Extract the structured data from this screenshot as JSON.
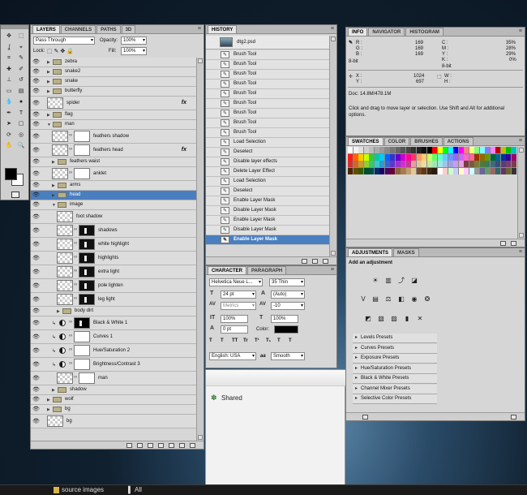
{
  "toolbar": {
    "tools": [
      {
        "name": "move-tool-icon",
        "glyph": "✥"
      },
      {
        "name": "marquee-tool-icon",
        "glyph": "⬚"
      },
      {
        "name": "lasso-tool-icon",
        "glyph": "ʆ"
      },
      {
        "name": "quick-select-tool-icon",
        "glyph": "⌖"
      },
      {
        "name": "crop-tool-icon",
        "glyph": "⌗"
      },
      {
        "name": "eyedropper-tool-icon",
        "glyph": "✎"
      },
      {
        "name": "healing-tool-icon",
        "glyph": "✚"
      },
      {
        "name": "brush-tool-icon",
        "glyph": "✐"
      },
      {
        "name": "stamp-tool-icon",
        "glyph": "⊥"
      },
      {
        "name": "history-brush-tool-icon",
        "glyph": "↺"
      },
      {
        "name": "eraser-tool-icon",
        "glyph": "▭"
      },
      {
        "name": "gradient-tool-icon",
        "glyph": "▤"
      },
      {
        "name": "blur-tool-icon",
        "glyph": "💧"
      },
      {
        "name": "dodge-tool-icon",
        "glyph": "●"
      },
      {
        "name": "pen-tool-icon",
        "glyph": "✒"
      },
      {
        "name": "type-tool-icon",
        "glyph": "T"
      },
      {
        "name": "path-select-tool-icon",
        "glyph": "➤"
      },
      {
        "name": "shape-tool-icon",
        "glyph": "▢"
      },
      {
        "name": "3d-rotate-tool-icon",
        "glyph": "⟳"
      },
      {
        "name": "3d-orbit-tool-icon",
        "glyph": "◎"
      },
      {
        "name": "hand-tool-icon",
        "glyph": "✋"
      },
      {
        "name": "zoom-tool-icon",
        "glyph": "🔍"
      }
    ]
  },
  "layers_panel": {
    "tabs": [
      "LAYERS",
      "CHANNELS",
      "PATHS",
      "3D"
    ],
    "blend_mode": "Pass Through",
    "opacity_label": "Opacity:",
    "opacity": "100%",
    "lock_label": "Lock:",
    "fill_label": "Fill:",
    "fill": "100%",
    "layers": [
      {
        "name": "zebra",
        "type": "group"
      },
      {
        "name": "snake2",
        "type": "group"
      },
      {
        "name": "snake",
        "type": "group"
      },
      {
        "name": "butterfly",
        "type": "group"
      },
      {
        "name": "spider",
        "type": "pixel",
        "fx": "fx"
      },
      {
        "name": "flag",
        "type": "group"
      },
      {
        "name": "man",
        "type": "group"
      },
      {
        "name": "feathers shadow",
        "type": "masked"
      },
      {
        "name": "feathers head",
        "type": "masked",
        "fx": "fx"
      },
      {
        "name": "feathers waist",
        "type": "group"
      },
      {
        "name": "anklet",
        "type": "masked"
      },
      {
        "name": "arms",
        "type": "group"
      },
      {
        "name": "head",
        "type": "group"
      },
      {
        "name": "image",
        "type": "group"
      },
      {
        "name": "foot shadow",
        "type": "pixel"
      },
      {
        "name": "shadows",
        "type": "masked"
      },
      {
        "name": "white highlight",
        "type": "masked"
      },
      {
        "name": "highlights",
        "type": "masked"
      },
      {
        "name": "extra light",
        "type": "masked"
      },
      {
        "name": "pole lighten",
        "type": "masked"
      },
      {
        "name": "leg light",
        "type": "masked"
      },
      {
        "name": "body dirt",
        "type": "group"
      },
      {
        "name": "Black & White 1",
        "type": "adjustment"
      },
      {
        "name": "Curves 1",
        "type": "adjustment"
      },
      {
        "name": "Hue/Saturation 2",
        "type": "adjustment"
      },
      {
        "name": "Brightness/Contrast 3",
        "type": "adjustment"
      },
      {
        "name": "man",
        "type": "masked"
      },
      {
        "name": "shadow",
        "type": "group"
      },
      {
        "name": "wolf",
        "type": "group"
      },
      {
        "name": "bg",
        "type": "group"
      },
      {
        "name": "bg",
        "type": "pixel"
      }
    ],
    "footer_icons": [
      "link-layers-icon",
      "fx-icon",
      "add-mask-icon",
      "adjustment-layer-icon",
      "new-group-icon",
      "new-layer-icon",
      "trash-icon"
    ]
  },
  "history_panel": {
    "tab": "HISTORY",
    "snapshot": "dtg2.psd",
    "states": [
      "Brush Tool",
      "Brush Tool",
      "Brush Tool",
      "Brush Tool",
      "Brush Tool",
      "Brush Tool",
      "Brush Tool",
      "Brush Tool",
      "Brush Tool",
      "Load Selection",
      "Deselect",
      "Disable layer effects",
      "Delete Layer Effect",
      "Load Selection",
      "Deselect",
      "Enable Layer Mask",
      "Disable Layer Mask",
      "Enable Layer Mask",
      "Disable Layer Mask",
      "Enable Layer Mask"
    ]
  },
  "character_panel": {
    "tabs": [
      "CHARACTER",
      "PARAGRAPH"
    ],
    "font_family": "Helvetica Neue L...",
    "font_style": "35 Thin",
    "font_size": "24 pt",
    "leading": "(Auto)",
    "kerning": "Metrics",
    "tracking": "-10",
    "vertical_scale": "100%",
    "horizontal_scale": "100%",
    "baseline_shift": "0 pt",
    "color_label": "Color:",
    "style_buttons": [
      "T",
      "T",
      "TT",
      "Tr",
      "T¹",
      "T₁",
      "T",
      "T"
    ],
    "language": "English: USA",
    "aa_label": "aa",
    "antialias": "Smooth"
  },
  "shared_window": {
    "label": "Shared"
  },
  "info_panel": {
    "tabs": [
      "INFO",
      "NAVIGATOR",
      "HISTOGRAM"
    ],
    "r_label": "R :",
    "g_label": "G :",
    "b_label": "B :",
    "r": "169",
    "g": "169",
    "b": "169",
    "c_label": "C :",
    "m_label": "M :",
    "y_label": "Y :",
    "k_label": "K :",
    "c": "35%",
    "m": "28%",
    "y": "29%",
    "k": "0%",
    "bit_left": "8-bit",
    "bit_right": "8-bit",
    "x_label": "X :",
    "y2_label": "Y :",
    "x": "1024",
    "y2": "697",
    "w_label": "W :",
    "h_label": "H :",
    "doc": "Doc: 14.8M/478.1M",
    "hint": "Click and drag to move layer or selection.  Use Shift and Alt for additional options."
  },
  "swatches_panel": {
    "tabs": [
      "SWATCHES",
      "COLOR",
      "BRUSHES",
      "ACTIONS"
    ],
    "row1": [
      "#ffffff",
      "#f2f2f2",
      "#e0e0e0",
      "#cfcfcf",
      "#bdbdbd",
      "#acacac",
      "#9a9a9a",
      "#898989",
      "#777777",
      "#666666",
      "#555555",
      "#444444",
      "#333333",
      "#222222",
      "#111111",
      "#000000",
      "#ff0000",
      "#ffff00",
      "#00ff00",
      "#00ffff",
      "#0000ff",
      "#ff00ff",
      "#ff8080",
      "#ffff80",
      "#80ff80",
      "#80ffff",
      "#8080ff",
      "#ff80ff",
      "#c00000",
      "#c0c000",
      "#00c000",
      "#00c0c0"
    ],
    "row2": [
      "#ff1a1a",
      "#ff6600",
      "#ffcc00",
      "#ccff00",
      "#33cc33",
      "#00cc99",
      "#00ccff",
      "#0066ff",
      "#3333cc",
      "#6600cc",
      "#cc00cc",
      "#ff0099",
      "#ff3366",
      "#ff9966",
      "#ffcc66",
      "#ccff66",
      "#66ff66",
      "#66ffcc",
      "#66ccff",
      "#6699ff",
      "#9966ff",
      "#cc66ff",
      "#ff66cc",
      "#ff6699",
      "#993300",
      "#996600",
      "#669900",
      "#006633",
      "#006699",
      "#003399",
      "#330099",
      "#990066"
    ],
    "row3": [
      "#cc3333",
      "#cc6633",
      "#cc9933",
      "#99cc33",
      "#33cc66",
      "#33cccc",
      "#3399cc",
      "#3366cc",
      "#6633cc",
      "#9933cc",
      "#cc33cc",
      "#cc3399",
      "#e6a0a0",
      "#e6c4a0",
      "#e6e0a0",
      "#c4e6a0",
      "#a0e6b4",
      "#a0e6e6",
      "#a0c4e6",
      "#a0a0e6",
      "#c4a0e6",
      "#e6a0e0",
      "#7a3d3d",
      "#7a5a3d",
      "#7a7a3d",
      "#4d7a3d",
      "#3d7a5a",
      "#3d6d7a",
      "#3d4d7a",
      "#5a3d7a",
      "#7a3d6d",
      "#7a3d4d"
    ],
    "row4": [
      "#4d2600",
      "#664d00",
      "#335c00",
      "#004d26",
      "#004d4d",
      "#002e66",
      "#1a0066",
      "#4d0066",
      "#660033",
      "#8c6239",
      "#a67c52",
      "#c69c6d",
      "#e3c79b",
      "#754c24",
      "#603913",
      "#3c2415",
      "#2b1a0f",
      "#ffffff",
      "#ffcccc",
      "#ccffcc",
      "#ccccff",
      "#ffffcc",
      "#ffccff",
      "#ccffff",
      "#999999",
      "#666699",
      "#669966",
      "#996666",
      "#336666",
      "#663366",
      "#666633",
      "#333333"
    ]
  },
  "adjustments_panel": {
    "tabs": [
      "ADJUSTMENTS",
      "MASKS"
    ],
    "heading": "Add an adjustment",
    "row1_icons": [
      "brightness-contrast-icon",
      "levels-icon",
      "curves-icon",
      "exposure-icon"
    ],
    "row2_icons": [
      "vibrance-icon",
      "hue-saturation-icon",
      "color-balance-icon",
      "black-white-icon",
      "photo-filter-icon",
      "channel-mixer-icon"
    ],
    "row3_icons": [
      "invert-icon",
      "posterize-icon",
      "threshold-icon",
      "gradient-map-icon",
      "selective-color-icon"
    ],
    "presets": [
      "Levels Presets",
      "Curves Presets",
      "Exposure Presets",
      "Hue/Saturation Presets",
      "Black & White Presets",
      "Channel Mixer Presets",
      "Selective Color Presets"
    ]
  },
  "taskbar": {
    "folder": "source images",
    "all_label": "All"
  }
}
